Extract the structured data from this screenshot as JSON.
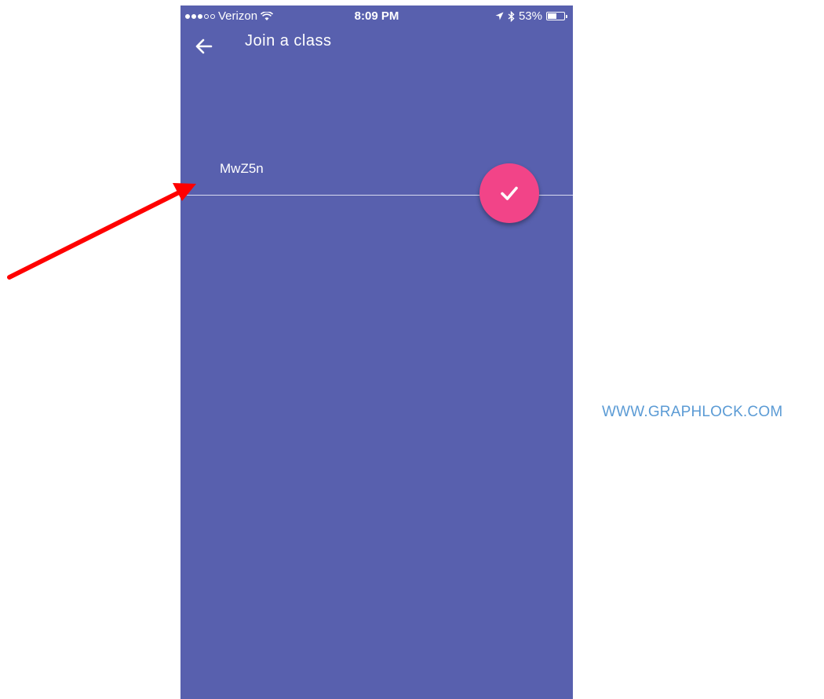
{
  "status_bar": {
    "carrier": "Verizon",
    "time": "8:09 PM",
    "battery": "53%",
    "battery_level": 0.53,
    "signal_bars_filled": 3,
    "signal_bars_total": 5
  },
  "app_bar": {
    "title": "Join a class",
    "back_icon": "arrow-left-icon"
  },
  "form": {
    "class_code_value": "MwZ5n",
    "submit_icon": "check-icon"
  },
  "watermark": "WWW.GRAPHLOCK.COM",
  "colors": {
    "background": "#5860ae",
    "accent": "#f24488",
    "annotation_arrow": "#ff0000",
    "watermark": "#5b9bd5"
  }
}
